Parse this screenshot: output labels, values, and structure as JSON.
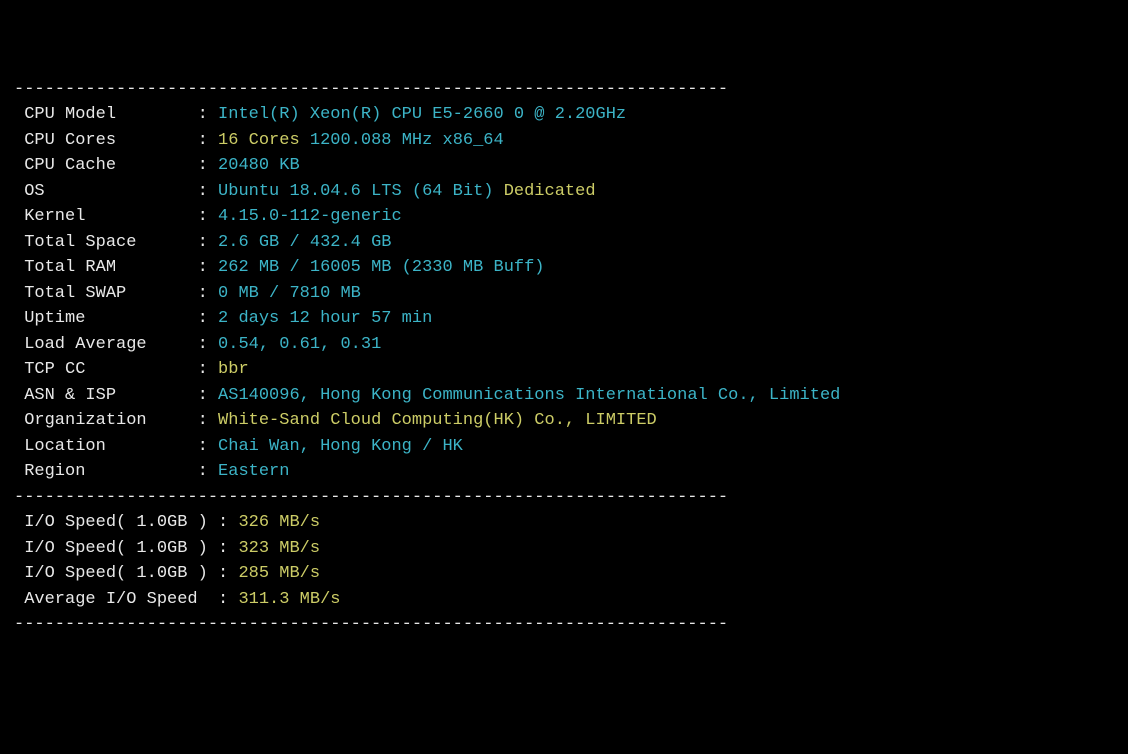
{
  "dash": "----------------------------------------------------------------------",
  "rows": [
    {
      "label": "CPU Model       ",
      "segments": [
        {
          "text": "Intel(R) Xeon(R) CPU E5-2660 0 @ 2.20GHz",
          "class": "cyan"
        }
      ]
    },
    {
      "label": "CPU Cores       ",
      "segments": [
        {
          "text": "16 Cores",
          "class": "yellow"
        },
        {
          "text": " 1200.088 MHz x86_64",
          "class": "cyan"
        }
      ]
    },
    {
      "label": "CPU Cache       ",
      "segments": [
        {
          "text": "20480 KB",
          "class": "cyan"
        }
      ]
    },
    {
      "label": "OS              ",
      "segments": [
        {
          "text": "Ubuntu 18.04.6 LTS (64 Bit)",
          "class": "cyan"
        },
        {
          "text": " Dedicated",
          "class": "yellow"
        }
      ]
    },
    {
      "label": "Kernel          ",
      "segments": [
        {
          "text": "4.15.0-112-generic",
          "class": "cyan"
        }
      ]
    },
    {
      "label": "Total Space     ",
      "segments": [
        {
          "text": "2.6 GB / 432.4 GB",
          "class": "cyan"
        }
      ]
    },
    {
      "label": "Total RAM       ",
      "segments": [
        {
          "text": "262 MB / 16005 MB (2330 MB Buff)",
          "class": "cyan"
        }
      ]
    },
    {
      "label": "Total SWAP      ",
      "segments": [
        {
          "text": "0 MB / 7810 MB",
          "class": "cyan"
        }
      ]
    },
    {
      "label": "Uptime          ",
      "segments": [
        {
          "text": "2 days 12 hour 57 min",
          "class": "cyan"
        }
      ]
    },
    {
      "label": "Load Average    ",
      "segments": [
        {
          "text": "0.54, 0.61, 0.31",
          "class": "cyan"
        }
      ]
    },
    {
      "label": "TCP CC          ",
      "segments": [
        {
          "text": "bbr",
          "class": "yellow"
        }
      ]
    },
    {
      "label": "ASN & ISP       ",
      "segments": [
        {
          "text": "AS140096, Hong Kong Communications International Co., Limited",
          "class": "cyan"
        }
      ]
    },
    {
      "label": "Organization    ",
      "segments": [
        {
          "text": "White-Sand Cloud Computing(HK) Co., LIMITED",
          "class": "yellow"
        }
      ]
    },
    {
      "label": "Location        ",
      "segments": [
        {
          "text": "Chai Wan, Hong Kong / HK",
          "class": "cyan"
        }
      ]
    },
    {
      "label": "Region          ",
      "segments": [
        {
          "text": "Eastern",
          "class": "cyan"
        }
      ]
    }
  ],
  "io_rows": [
    {
      "label": "I/O Speed( 1.0GB )",
      "value": "326 MB/s"
    },
    {
      "label": "I/O Speed( 1.0GB )",
      "value": "323 MB/s"
    },
    {
      "label": "I/O Speed( 1.0GB )",
      "value": "285 MB/s"
    },
    {
      "label": "Average I/O Speed ",
      "value": "311.3 MB/s"
    }
  ]
}
